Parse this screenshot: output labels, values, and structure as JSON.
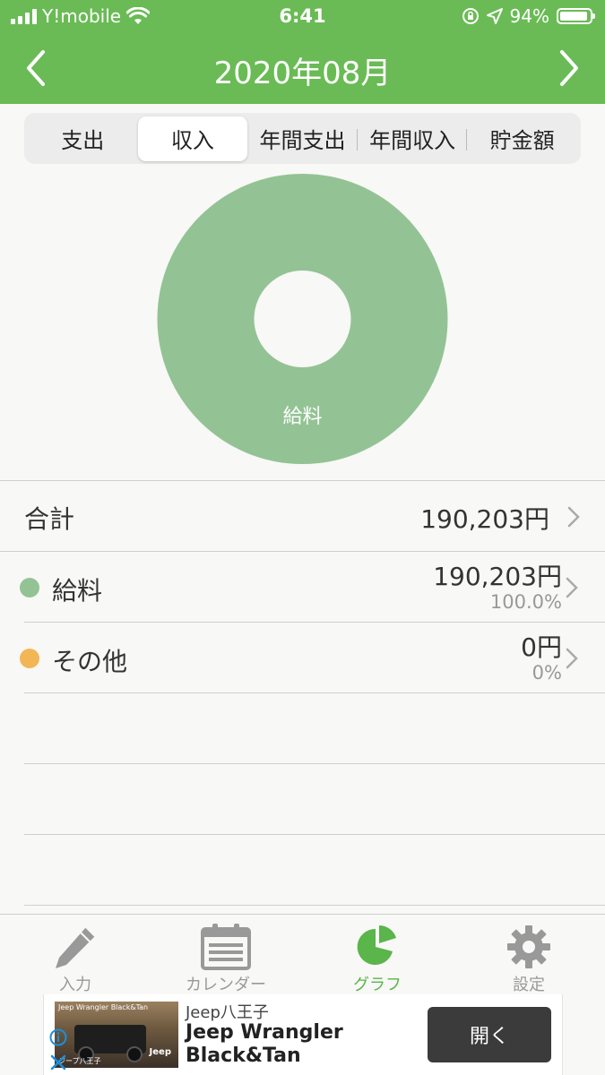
{
  "status_bar": {
    "carrier": "Y!mobile",
    "time": "6:41",
    "battery_percent": "94%",
    "battery_level": 0.94
  },
  "header": {
    "title": "2020年08月",
    "prev_icon": "chevron-left-icon",
    "next_icon": "chevron-right-icon"
  },
  "segments": [
    {
      "label": "支出",
      "selected": false
    },
    {
      "label": "収入",
      "selected": true
    },
    {
      "label": "年間支出",
      "selected": false
    },
    {
      "label": "年間収入",
      "selected": false
    },
    {
      "label": "貯金額",
      "selected": false
    }
  ],
  "chart_data": {
    "type": "pie",
    "donut": true,
    "categories": [
      "給料",
      "その他"
    ],
    "values": [
      190203,
      0
    ],
    "slice_labels": [
      "給料",
      ""
    ],
    "colors": [
      "#93c394",
      "#f2b657"
    ]
  },
  "summary": {
    "total_label": "合計",
    "total_value": "190,203円"
  },
  "categories": [
    {
      "name": "給料",
      "amount": "190,203円",
      "percent": "100.0%",
      "color": "#93c394"
    },
    {
      "name": "その他",
      "amount": "0円",
      "percent": "0%",
      "color": "#f2b657"
    }
  ],
  "tab_bar": {
    "tabs": [
      {
        "label": "入力",
        "icon": "pencil-icon",
        "active": false
      },
      {
        "label": "カレンダー",
        "icon": "calendar-icon",
        "active": false
      },
      {
        "label": "グラフ",
        "icon": "pie-chart-icon",
        "active": true
      },
      {
        "label": "設定",
        "icon": "gear-icon",
        "active": false
      }
    ]
  },
  "ad": {
    "advertiser": "Jeep八王子",
    "headline": "Jeep Wrangler Black&Tan",
    "cta": "開く",
    "image_caption": "Jeep Wrangler Black&Tan",
    "image_brand": "Jeep",
    "image_footer": "ジープ八王子"
  },
  "colors": {
    "header_green": "#6abb55",
    "active_tab_green": "#5ab54a",
    "inactive_gray": "#999999"
  }
}
